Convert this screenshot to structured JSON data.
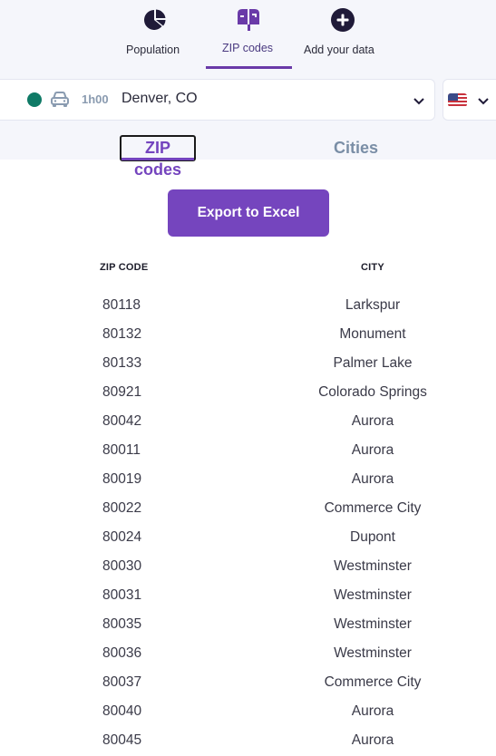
{
  "nav": {
    "items": [
      {
        "label": "Population",
        "icon": "pie-chart-icon",
        "active": false
      },
      {
        "label": "ZIP codes",
        "icon": "mailbox-icon",
        "active": true
      },
      {
        "label": "Add your data",
        "icon": "plus-circle-icon",
        "active": false
      }
    ]
  },
  "location_select": {
    "status_color": "#0f7a66",
    "transport_icon": "car-icon",
    "travel_time": "1h00",
    "place": "Denver, CO"
  },
  "country_select": {
    "flag": "us-flag-icon"
  },
  "subtabs": [
    {
      "label": "ZIP codes",
      "active": true
    },
    {
      "label": "Cities",
      "active": false
    }
  ],
  "export_button": "Export to Excel",
  "table": {
    "headers": {
      "zip": "ZIP CODE",
      "city": "CITY"
    },
    "rows": [
      {
        "zip": "80118",
        "city": "Larkspur"
      },
      {
        "zip": "80132",
        "city": "Monument"
      },
      {
        "zip": "80133",
        "city": "Palmer Lake"
      },
      {
        "zip": "80921",
        "city": "Colorado Springs"
      },
      {
        "zip": "80042",
        "city": "Aurora"
      },
      {
        "zip": "80011",
        "city": "Aurora"
      },
      {
        "zip": "80019",
        "city": "Aurora"
      },
      {
        "zip": "80022",
        "city": "Commerce City"
      },
      {
        "zip": "80024",
        "city": "Dupont"
      },
      {
        "zip": "80030",
        "city": "Westminster"
      },
      {
        "zip": "80031",
        "city": "Westminster"
      },
      {
        "zip": "80035",
        "city": "Westminster"
      },
      {
        "zip": "80036",
        "city": "Westminster"
      },
      {
        "zip": "80037",
        "city": "Commerce City"
      },
      {
        "zip": "80040",
        "city": "Aurora"
      },
      {
        "zip": "80045",
        "city": "Aurora"
      }
    ]
  },
  "colors": {
    "accent": "#7545be",
    "nav_active": "#6a3aa8",
    "background": "#f5f6fb"
  }
}
